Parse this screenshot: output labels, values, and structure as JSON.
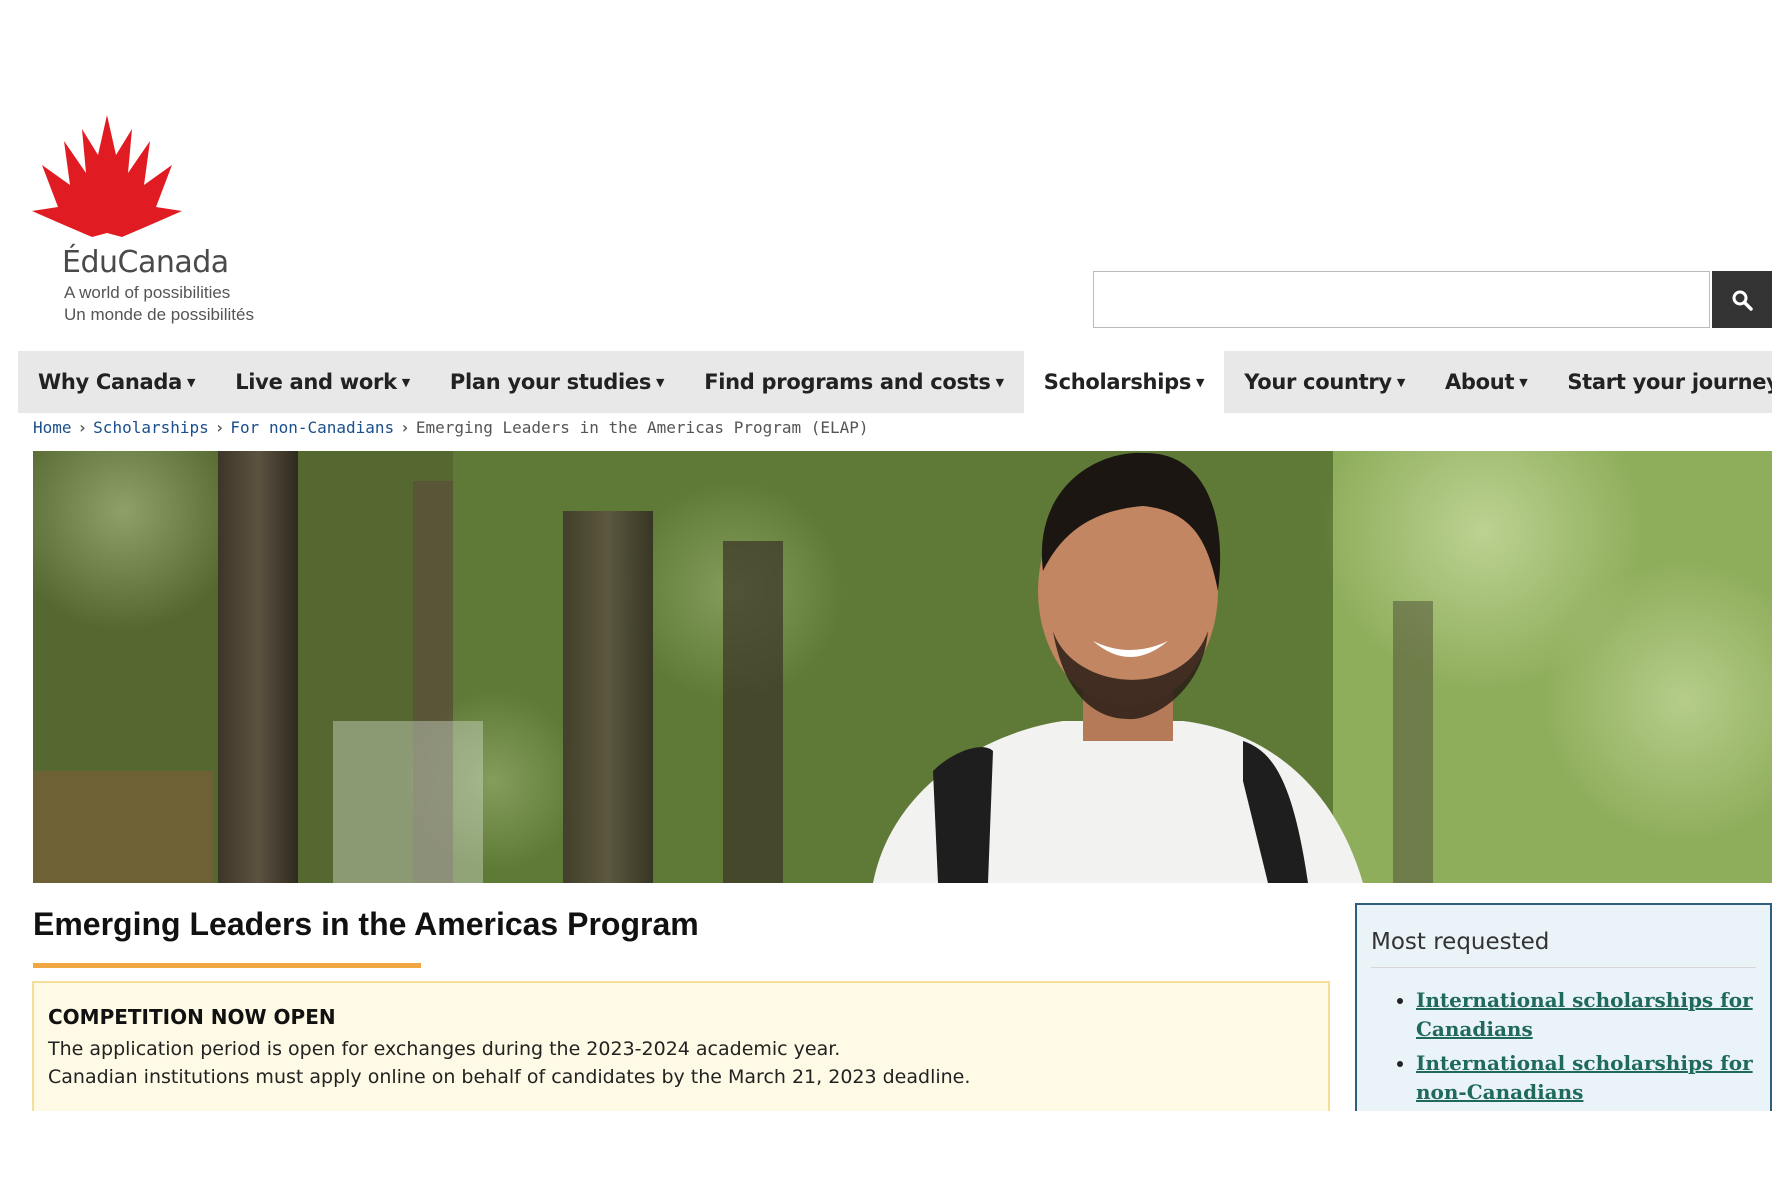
{
  "logo": {
    "brand": "ÉduCanada",
    "tagline_en": "A world of possibilities",
    "tagline_fr": "Un monde de possibilités",
    "accent_color": "#e11b22"
  },
  "search": {
    "placeholder": "",
    "value": "",
    "icon": "search-icon"
  },
  "nav": {
    "items": [
      {
        "label": "Why Canada"
      },
      {
        "label": "Live and work"
      },
      {
        "label": "Plan your studies"
      },
      {
        "label": "Find programs and costs"
      },
      {
        "label": "Scholarships"
      },
      {
        "label": "Your country"
      },
      {
        "label": "About"
      },
      {
        "label": "Start your journey"
      }
    ],
    "active": "Scholarships"
  },
  "breadcrumb": {
    "items": [
      {
        "label": "Home"
      },
      {
        "label": "Scholarships"
      },
      {
        "label": "For non-Canadians"
      },
      {
        "label": "Emerging Leaders in the Americas Program (ELAP)"
      }
    ]
  },
  "main": {
    "title": "Emerging Leaders in the Americas Program",
    "notice": {
      "title": "COMPETITION NOW OPEN",
      "line1": "The application period is open for exchanges during the 2023-2024 academic year.",
      "line2": "Canadian institutions must apply online on behalf of candidates by the March 21, 2023 deadline."
    }
  },
  "sidebar": {
    "title": "Most requested",
    "links": [
      {
        "label": "International scholarships for Canadians"
      },
      {
        "label": "International scholarships for non-Canadians"
      }
    ]
  },
  "colors": {
    "title_underline": "#f0a742",
    "link": "#1f6a5a",
    "nav_bg": "#e8e8e8",
    "notice_bg": "#fffae6",
    "sidebar_border": "#2e5f7e"
  }
}
